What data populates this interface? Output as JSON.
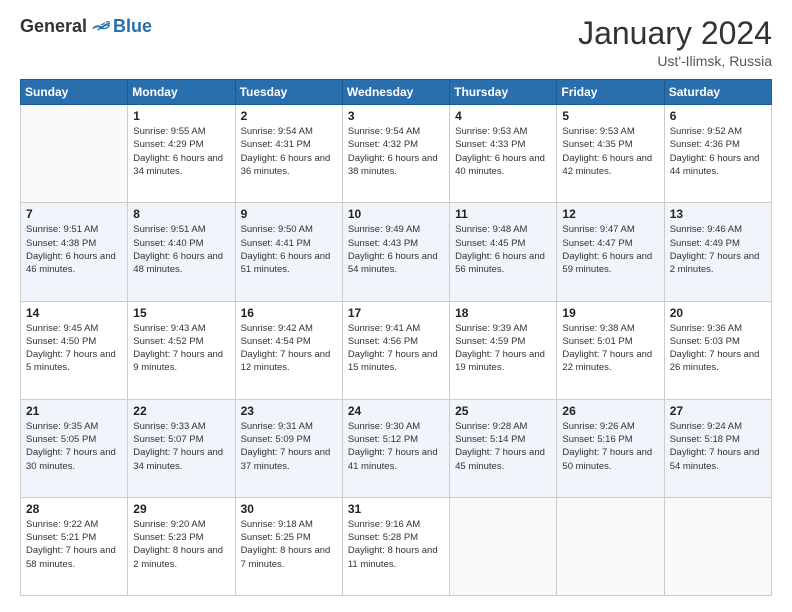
{
  "logo": {
    "general": "General",
    "blue": "Blue"
  },
  "title": "January 2024",
  "location": "Ust'-Ilimsk, Russia",
  "days_of_week": [
    "Sunday",
    "Monday",
    "Tuesday",
    "Wednesday",
    "Thursday",
    "Friday",
    "Saturday"
  ],
  "weeks": [
    [
      {
        "day": "",
        "sunrise": "",
        "sunset": "",
        "daylight": ""
      },
      {
        "day": "1",
        "sunrise": "Sunrise: 9:55 AM",
        "sunset": "Sunset: 4:29 PM",
        "daylight": "Daylight: 6 hours and 34 minutes."
      },
      {
        "day": "2",
        "sunrise": "Sunrise: 9:54 AM",
        "sunset": "Sunset: 4:31 PM",
        "daylight": "Daylight: 6 hours and 36 minutes."
      },
      {
        "day": "3",
        "sunrise": "Sunrise: 9:54 AM",
        "sunset": "Sunset: 4:32 PM",
        "daylight": "Daylight: 6 hours and 38 minutes."
      },
      {
        "day": "4",
        "sunrise": "Sunrise: 9:53 AM",
        "sunset": "Sunset: 4:33 PM",
        "daylight": "Daylight: 6 hours and 40 minutes."
      },
      {
        "day": "5",
        "sunrise": "Sunrise: 9:53 AM",
        "sunset": "Sunset: 4:35 PM",
        "daylight": "Daylight: 6 hours and 42 minutes."
      },
      {
        "day": "6",
        "sunrise": "Sunrise: 9:52 AM",
        "sunset": "Sunset: 4:36 PM",
        "daylight": "Daylight: 6 hours and 44 minutes."
      }
    ],
    [
      {
        "day": "7",
        "sunrise": "Sunrise: 9:51 AM",
        "sunset": "Sunset: 4:38 PM",
        "daylight": "Daylight: 6 hours and 46 minutes."
      },
      {
        "day": "8",
        "sunrise": "Sunrise: 9:51 AM",
        "sunset": "Sunset: 4:40 PM",
        "daylight": "Daylight: 6 hours and 48 minutes."
      },
      {
        "day": "9",
        "sunrise": "Sunrise: 9:50 AM",
        "sunset": "Sunset: 4:41 PM",
        "daylight": "Daylight: 6 hours and 51 minutes."
      },
      {
        "day": "10",
        "sunrise": "Sunrise: 9:49 AM",
        "sunset": "Sunset: 4:43 PM",
        "daylight": "Daylight: 6 hours and 54 minutes."
      },
      {
        "day": "11",
        "sunrise": "Sunrise: 9:48 AM",
        "sunset": "Sunset: 4:45 PM",
        "daylight": "Daylight: 6 hours and 56 minutes."
      },
      {
        "day": "12",
        "sunrise": "Sunrise: 9:47 AM",
        "sunset": "Sunset: 4:47 PM",
        "daylight": "Daylight: 6 hours and 59 minutes."
      },
      {
        "day": "13",
        "sunrise": "Sunrise: 9:46 AM",
        "sunset": "Sunset: 4:49 PM",
        "daylight": "Daylight: 7 hours and 2 minutes."
      }
    ],
    [
      {
        "day": "14",
        "sunrise": "Sunrise: 9:45 AM",
        "sunset": "Sunset: 4:50 PM",
        "daylight": "Daylight: 7 hours and 5 minutes."
      },
      {
        "day": "15",
        "sunrise": "Sunrise: 9:43 AM",
        "sunset": "Sunset: 4:52 PM",
        "daylight": "Daylight: 7 hours and 9 minutes."
      },
      {
        "day": "16",
        "sunrise": "Sunrise: 9:42 AM",
        "sunset": "Sunset: 4:54 PM",
        "daylight": "Daylight: 7 hours and 12 minutes."
      },
      {
        "day": "17",
        "sunrise": "Sunrise: 9:41 AM",
        "sunset": "Sunset: 4:56 PM",
        "daylight": "Daylight: 7 hours and 15 minutes."
      },
      {
        "day": "18",
        "sunrise": "Sunrise: 9:39 AM",
        "sunset": "Sunset: 4:59 PM",
        "daylight": "Daylight: 7 hours and 19 minutes."
      },
      {
        "day": "19",
        "sunrise": "Sunrise: 9:38 AM",
        "sunset": "Sunset: 5:01 PM",
        "daylight": "Daylight: 7 hours and 22 minutes."
      },
      {
        "day": "20",
        "sunrise": "Sunrise: 9:36 AM",
        "sunset": "Sunset: 5:03 PM",
        "daylight": "Daylight: 7 hours and 26 minutes."
      }
    ],
    [
      {
        "day": "21",
        "sunrise": "Sunrise: 9:35 AM",
        "sunset": "Sunset: 5:05 PM",
        "daylight": "Daylight: 7 hours and 30 minutes."
      },
      {
        "day": "22",
        "sunrise": "Sunrise: 9:33 AM",
        "sunset": "Sunset: 5:07 PM",
        "daylight": "Daylight: 7 hours and 34 minutes."
      },
      {
        "day": "23",
        "sunrise": "Sunrise: 9:31 AM",
        "sunset": "Sunset: 5:09 PM",
        "daylight": "Daylight: 7 hours and 37 minutes."
      },
      {
        "day": "24",
        "sunrise": "Sunrise: 9:30 AM",
        "sunset": "Sunset: 5:12 PM",
        "daylight": "Daylight: 7 hours and 41 minutes."
      },
      {
        "day": "25",
        "sunrise": "Sunrise: 9:28 AM",
        "sunset": "Sunset: 5:14 PM",
        "daylight": "Daylight: 7 hours and 45 minutes."
      },
      {
        "day": "26",
        "sunrise": "Sunrise: 9:26 AM",
        "sunset": "Sunset: 5:16 PM",
        "daylight": "Daylight: 7 hours and 50 minutes."
      },
      {
        "day": "27",
        "sunrise": "Sunrise: 9:24 AM",
        "sunset": "Sunset: 5:18 PM",
        "daylight": "Daylight: 7 hours and 54 minutes."
      }
    ],
    [
      {
        "day": "28",
        "sunrise": "Sunrise: 9:22 AM",
        "sunset": "Sunset: 5:21 PM",
        "daylight": "Daylight: 7 hours and 58 minutes."
      },
      {
        "day": "29",
        "sunrise": "Sunrise: 9:20 AM",
        "sunset": "Sunset: 5:23 PM",
        "daylight": "Daylight: 8 hours and 2 minutes."
      },
      {
        "day": "30",
        "sunrise": "Sunrise: 9:18 AM",
        "sunset": "Sunset: 5:25 PM",
        "daylight": "Daylight: 8 hours and 7 minutes."
      },
      {
        "day": "31",
        "sunrise": "Sunrise: 9:16 AM",
        "sunset": "Sunset: 5:28 PM",
        "daylight": "Daylight: 8 hours and 11 minutes."
      },
      {
        "day": "",
        "sunrise": "",
        "sunset": "",
        "daylight": ""
      },
      {
        "day": "",
        "sunrise": "",
        "sunset": "",
        "daylight": ""
      },
      {
        "day": "",
        "sunrise": "",
        "sunset": "",
        "daylight": ""
      }
    ]
  ]
}
